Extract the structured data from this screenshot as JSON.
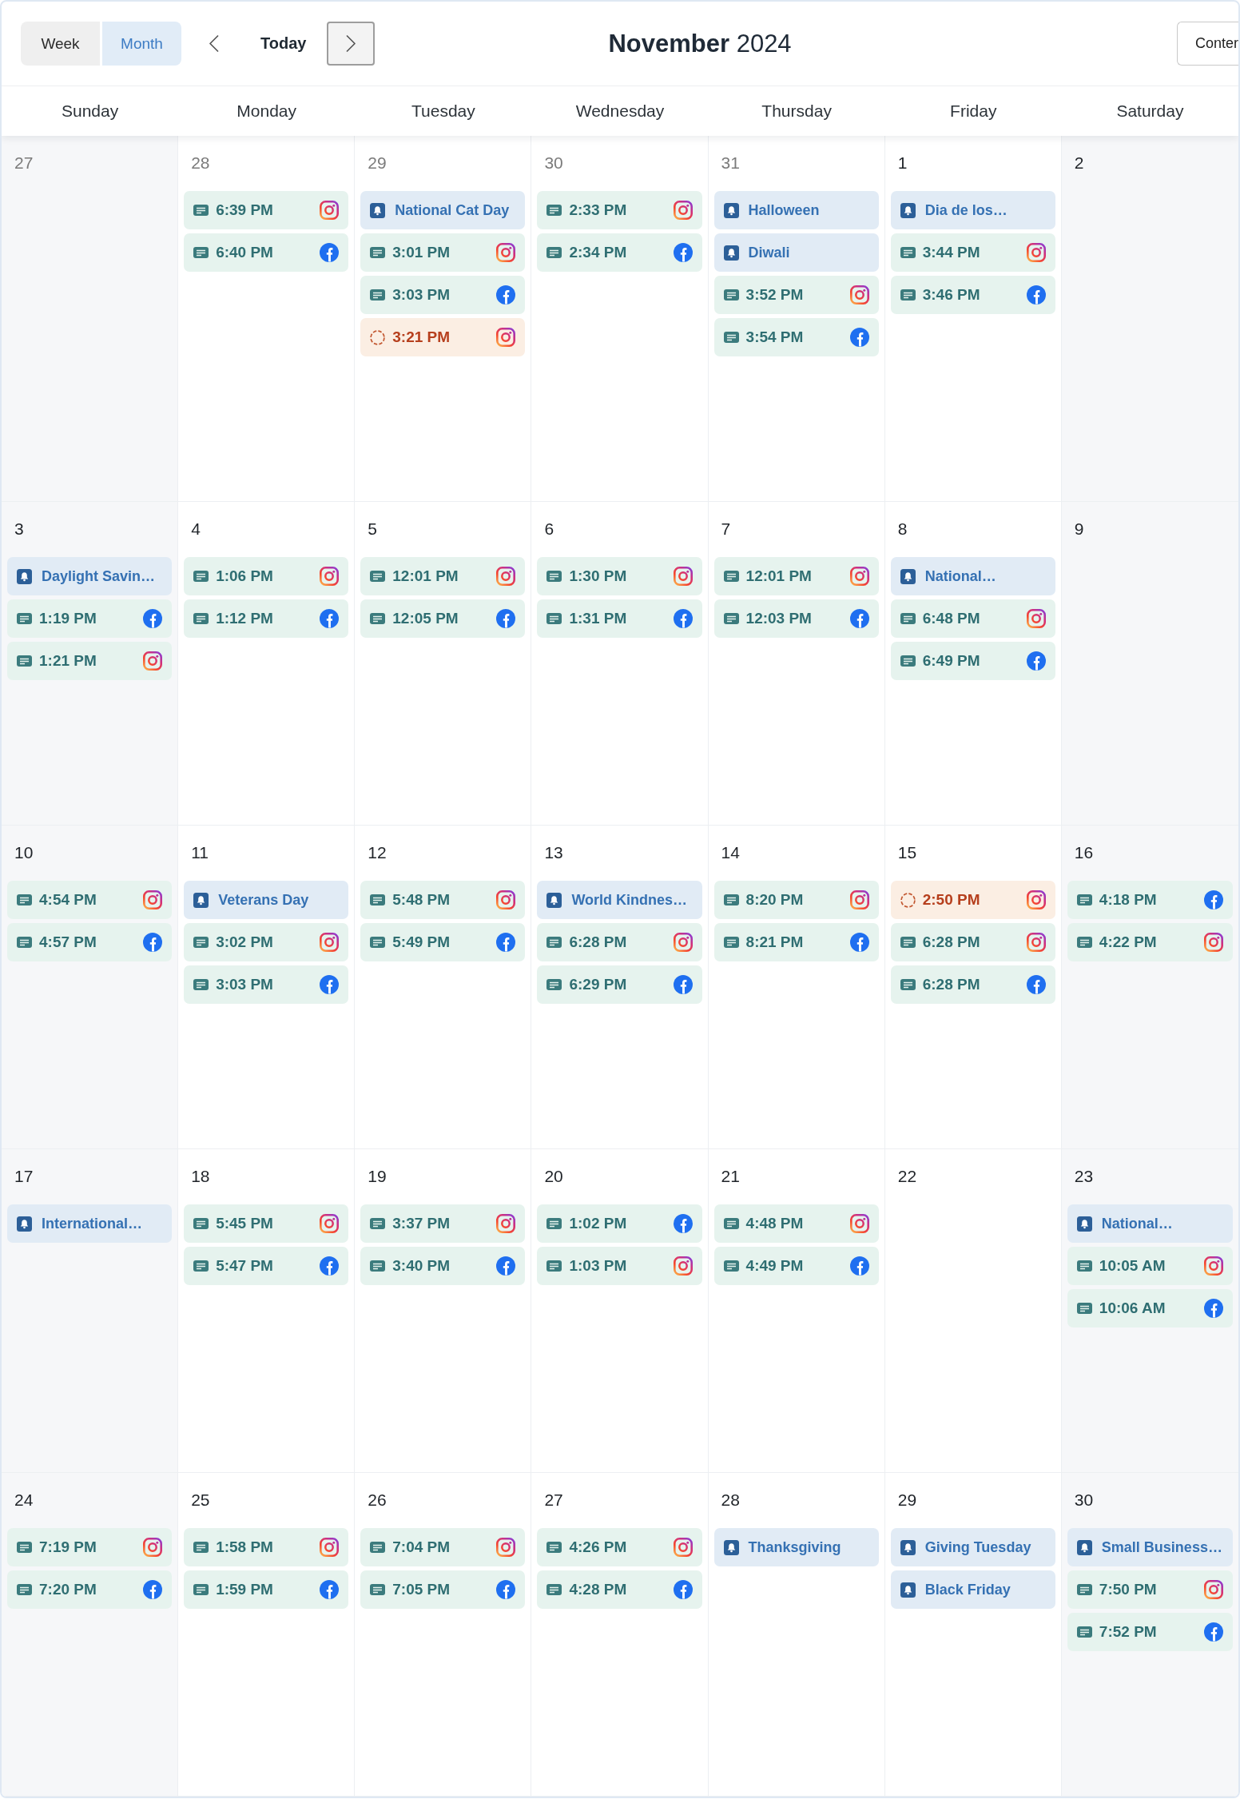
{
  "toolbar": {
    "view_tabs": [
      {
        "label": "Week",
        "selected": false
      },
      {
        "label": "Month",
        "selected": true
      }
    ],
    "previous": {
      "focused": false
    },
    "today": "Today",
    "next": {
      "focused": true
    },
    "title": "**November** 2024",
    "right_button": "Conter"
  },
  "weekdays": [
    "Sunday",
    "Monday",
    "Tuesday",
    "Wednesday",
    "Thursday",
    "Friday",
    "Saturday"
  ],
  "weeks": [
    {
      "days": [
        {
          "date": "27",
          "outside_month": true
        },
        {
          "date": "28",
          "outside_month": true,
          "events": [
            {
              "kind": "post",
              "time": "6:39 PM",
              "channel": {
                "kind": "instagram"
              }
            },
            {
              "kind": "post",
              "time": "6:40 PM",
              "channel": {
                "kind": "facebook"
              }
            }
          ]
        },
        {
          "date": "29",
          "outside_month": true,
          "events": [
            {
              "kind": "holiday",
              "title": "National Cat Day"
            },
            {
              "kind": "post",
              "time": "3:01 PM",
              "channel": {
                "kind": "instagram"
              }
            },
            {
              "kind": "post",
              "time": "3:03 PM",
              "channel": {
                "kind": "facebook"
              }
            },
            {
              "kind": "pending",
              "time": "3:21 PM",
              "channel": {
                "kind": "instagram"
              }
            }
          ]
        },
        {
          "date": "30",
          "outside_month": true,
          "events": [
            {
              "kind": "post",
              "time": "2:33 PM",
              "channel": {
                "kind": "instagram"
              }
            },
            {
              "kind": "post",
              "time": "2:34 PM",
              "channel": {
                "kind": "facebook"
              }
            }
          ]
        },
        {
          "date": "31",
          "outside_month": true,
          "events": [
            {
              "kind": "holiday",
              "title": "Halloween"
            },
            {
              "kind": "holiday",
              "title": "Diwali"
            },
            {
              "kind": "post",
              "time": "3:52 PM",
              "channel": {
                "kind": "instagram"
              }
            },
            {
              "kind": "post",
              "time": "3:54 PM",
              "channel": {
                "kind": "facebook"
              }
            }
          ]
        },
        {
          "date": "1",
          "outside_month": false,
          "events": [
            {
              "kind": "holiday",
              "title": "Dia de los…"
            },
            {
              "kind": "post",
              "time": "3:44 PM",
              "channel": {
                "kind": "instagram"
              }
            },
            {
              "kind": "post",
              "time": "3:46 PM",
              "channel": {
                "kind": "facebook"
              }
            }
          ]
        },
        {
          "date": "2",
          "outside_month": false
        }
      ]
    },
    {
      "days": [
        {
          "date": "3",
          "outside_month": false,
          "events": [
            {
              "kind": "holiday",
              "title": "Daylight Savin…"
            },
            {
              "kind": "post",
              "time": "1:19 PM",
              "channel": {
                "kind": "facebook"
              }
            },
            {
              "kind": "post",
              "time": "1:21 PM",
              "channel": {
                "kind": "instagram"
              }
            }
          ]
        },
        {
          "date": "4",
          "outside_month": false,
          "events": [
            {
              "kind": "post",
              "time": "1:06 PM",
              "channel": {
                "kind": "instagram"
              }
            },
            {
              "kind": "post",
              "time": "1:12 PM",
              "channel": {
                "kind": "facebook"
              }
            }
          ]
        },
        {
          "date": "5",
          "outside_month": false,
          "events": [
            {
              "kind": "post",
              "time": "12:01 PM",
              "channel": {
                "kind": "instagram"
              }
            },
            {
              "kind": "post",
              "time": "12:05 PM",
              "channel": {
                "kind": "facebook"
              }
            }
          ]
        },
        {
          "date": "6",
          "outside_month": false,
          "events": [
            {
              "kind": "post",
              "time": "1:30 PM",
              "channel": {
                "kind": "instagram"
              }
            },
            {
              "kind": "post",
              "time": "1:31 PM",
              "channel": {
                "kind": "facebook"
              }
            }
          ]
        },
        {
          "date": "7",
          "outside_month": false,
          "events": [
            {
              "kind": "post",
              "time": "12:01 PM",
              "channel": {
                "kind": "instagram"
              }
            },
            {
              "kind": "post",
              "time": "12:03 PM",
              "channel": {
                "kind": "facebook"
              }
            }
          ]
        },
        {
          "date": "8",
          "outside_month": false,
          "events": [
            {
              "kind": "holiday",
              "title": "National…"
            },
            {
              "kind": "post",
              "time": "6:48 PM",
              "channel": {
                "kind": "instagram"
              }
            },
            {
              "kind": "post",
              "time": "6:49 PM",
              "channel": {
                "kind": "facebook"
              }
            }
          ]
        },
        {
          "date": "9",
          "outside_month": false
        }
      ]
    },
    {
      "days": [
        {
          "date": "10",
          "outside_month": false,
          "events": [
            {
              "kind": "post",
              "time": "4:54 PM",
              "channel": {
                "kind": "instagram"
              }
            },
            {
              "kind": "post",
              "time": "4:57 PM",
              "channel": {
                "kind": "facebook"
              }
            }
          ]
        },
        {
          "date": "11",
          "outside_month": false,
          "events": [
            {
              "kind": "holiday",
              "title": "Veterans Day"
            },
            {
              "kind": "post",
              "time": "3:02 PM",
              "channel": {
                "kind": "instagram"
              }
            },
            {
              "kind": "post",
              "time": "3:03 PM",
              "channel": {
                "kind": "facebook"
              }
            }
          ]
        },
        {
          "date": "12",
          "outside_month": false,
          "events": [
            {
              "kind": "post",
              "time": "5:48 PM",
              "channel": {
                "kind": "instagram"
              }
            },
            {
              "kind": "post",
              "time": "5:49 PM",
              "channel": {
                "kind": "facebook"
              }
            }
          ]
        },
        {
          "date": "13",
          "outside_month": false,
          "events": [
            {
              "kind": "holiday",
              "title": "World Kindnes…"
            },
            {
              "kind": "post",
              "time": "6:28 PM",
              "channel": {
                "kind": "instagram"
              }
            },
            {
              "kind": "post",
              "time": "6:29 PM",
              "channel": {
                "kind": "facebook"
              }
            }
          ]
        },
        {
          "date": "14",
          "outside_month": false,
          "events": [
            {
              "kind": "post",
              "time": "8:20 PM",
              "channel": {
                "kind": "instagram"
              }
            },
            {
              "kind": "post",
              "time": "8:21 PM",
              "channel": {
                "kind": "facebook"
              }
            }
          ]
        },
        {
          "date": "15",
          "outside_month": false,
          "events": [
            {
              "kind": "pending",
              "time": "2:50 PM",
              "channel": {
                "kind": "instagram"
              }
            },
            {
              "kind": "post",
              "time": "6:28 PM",
              "channel": {
                "kind": "instagram"
              }
            },
            {
              "kind": "post",
              "time": "6:28 PM",
              "channel": {
                "kind": "facebook"
              }
            }
          ]
        },
        {
          "date": "16",
          "outside_month": false,
          "events": [
            {
              "kind": "post",
              "time": "4:18 PM",
              "channel": {
                "kind": "facebook"
              }
            },
            {
              "kind": "post",
              "time": "4:22 PM",
              "channel": {
                "kind": "instagram"
              }
            }
          ]
        }
      ]
    },
    {
      "days": [
        {
          "date": "17",
          "outside_month": false,
          "events": [
            {
              "kind": "holiday",
              "title": "International…"
            }
          ]
        },
        {
          "date": "18",
          "outside_month": false,
          "events": [
            {
              "kind": "post",
              "time": "5:45 PM",
              "channel": {
                "kind": "instagram"
              }
            },
            {
              "kind": "post",
              "time": "5:47 PM",
              "channel": {
                "kind": "facebook"
              }
            }
          ]
        },
        {
          "date": "19",
          "outside_month": false,
          "events": [
            {
              "kind": "post",
              "time": "3:37 PM",
              "channel": {
                "kind": "instagram"
              }
            },
            {
              "kind": "post",
              "time": "3:40 PM",
              "channel": {
                "kind": "facebook"
              }
            }
          ]
        },
        {
          "date": "20",
          "outside_month": false,
          "events": [
            {
              "kind": "post",
              "time": "1:02 PM",
              "channel": {
                "kind": "facebook"
              }
            },
            {
              "kind": "post",
              "time": "1:03 PM",
              "channel": {
                "kind": "instagram"
              }
            }
          ]
        },
        {
          "date": "21",
          "outside_month": false,
          "events": [
            {
              "kind": "post",
              "time": "4:48 PM",
              "channel": {
                "kind": "instagram"
              }
            },
            {
              "kind": "post",
              "time": "4:49 PM",
              "channel": {
                "kind": "facebook"
              }
            }
          ]
        },
        {
          "date": "22",
          "outside_month": false
        },
        {
          "date": "23",
          "outside_month": false,
          "events": [
            {
              "kind": "holiday",
              "title": "National…"
            },
            {
              "kind": "post",
              "time": "10:05 AM",
              "channel": {
                "kind": "instagram"
              }
            },
            {
              "kind": "post",
              "time": "10:06 AM",
              "channel": {
                "kind": "facebook"
              }
            }
          ]
        }
      ]
    },
    {
      "days": [
        {
          "date": "24",
          "outside_month": false,
          "events": [
            {
              "kind": "post",
              "time": "7:19 PM",
              "channel": {
                "kind": "instagram"
              }
            },
            {
              "kind": "post",
              "time": "7:20 PM",
              "channel": {
                "kind": "facebook"
              }
            }
          ]
        },
        {
          "date": "25",
          "outside_month": false,
          "events": [
            {
              "kind": "post",
              "time": "1:58 PM",
              "channel": {
                "kind": "instagram"
              }
            },
            {
              "kind": "post",
              "time": "1:59 PM",
              "channel": {
                "kind": "facebook"
              }
            }
          ]
        },
        {
          "date": "26",
          "outside_month": false,
          "events": [
            {
              "kind": "post",
              "time": "7:04 PM",
              "channel": {
                "kind": "instagram"
              }
            },
            {
              "kind": "post",
              "time": "7:05 PM",
              "channel": {
                "kind": "facebook"
              }
            }
          ]
        },
        {
          "date": "27",
          "outside_month": false,
          "events": [
            {
              "kind": "post",
              "time": "4:26 PM",
              "channel": {
                "kind": "instagram"
              }
            },
            {
              "kind": "post",
              "time": "4:28 PM",
              "channel": {
                "kind": "facebook"
              }
            }
          ]
        },
        {
          "date": "28",
          "outside_month": false,
          "events": [
            {
              "kind": "holiday",
              "title": "Thanksgiving"
            }
          ]
        },
        {
          "date": "29",
          "outside_month": false,
          "events": [
            {
              "kind": "holiday",
              "title": "Giving Tuesday"
            },
            {
              "kind": "holiday",
              "title": "Black Friday"
            }
          ]
        },
        {
          "date": "30",
          "outside_month": false,
          "events": [
            {
              "kind": "holiday",
              "title": "Small Business…"
            },
            {
              "kind": "post",
              "time": "7:50 PM",
              "channel": {
                "kind": "instagram"
              }
            },
            {
              "kind": "post",
              "time": "7:52 PM",
              "channel": {
                "kind": "facebook"
              }
            }
          ]
        }
      ]
    }
  ]
}
